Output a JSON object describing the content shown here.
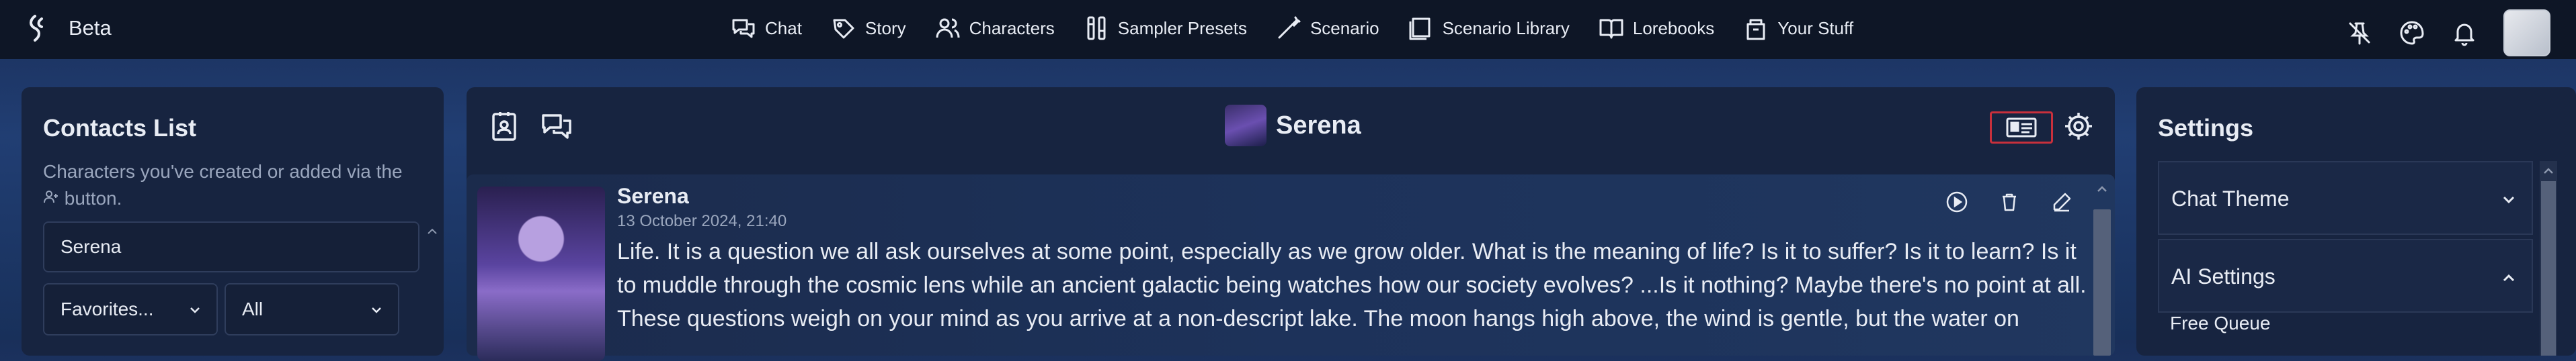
{
  "brand": {
    "name": "Beta"
  },
  "nav": [
    {
      "label": "Chat",
      "icon": "chat-icon"
    },
    {
      "label": "Story",
      "icon": "story-icon"
    },
    {
      "label": "Characters",
      "icon": "characters-icon"
    },
    {
      "label": "Sampler Presets",
      "icon": "sampler-icon"
    },
    {
      "label": "Scenario",
      "icon": "scenario-icon"
    },
    {
      "label": "Scenario Library",
      "icon": "library-icon"
    },
    {
      "label": "Lorebooks",
      "icon": "book-icon"
    },
    {
      "label": "Your Stuff",
      "icon": "box-icon"
    }
  ],
  "contacts": {
    "title": "Contacts List",
    "description": "Characters you've created or added via the",
    "description_tail": "button.",
    "search_value": "Serena",
    "filter_value": "Favorites...",
    "sort_value": "All"
  },
  "chat": {
    "character_name": "Serena"
  },
  "message": {
    "name": "Serena",
    "time": "13 October 2024, 21:40",
    "text": "Life. It is a question we all ask ourselves at some point, especially as we grow older. What is the meaning of life? Is it to suffer? Is it to learn? Is it to muddle through the cosmic lens while an ancient galactic being watches how our society evolves? ...Is it nothing? Maybe there's no point at all. These questions weigh on your mind as you arrive at a non-descript lake. The moon hangs high above, the wind is gentle, but the water on"
  },
  "settings": {
    "title": "Settings",
    "chat_theme": "Chat Theme",
    "ai_settings": "AI Settings",
    "free_queue": "Free Queue"
  },
  "colors": {
    "accent_border": "#c8303c",
    "panel": "#172440",
    "topbar": "#0e1626"
  }
}
